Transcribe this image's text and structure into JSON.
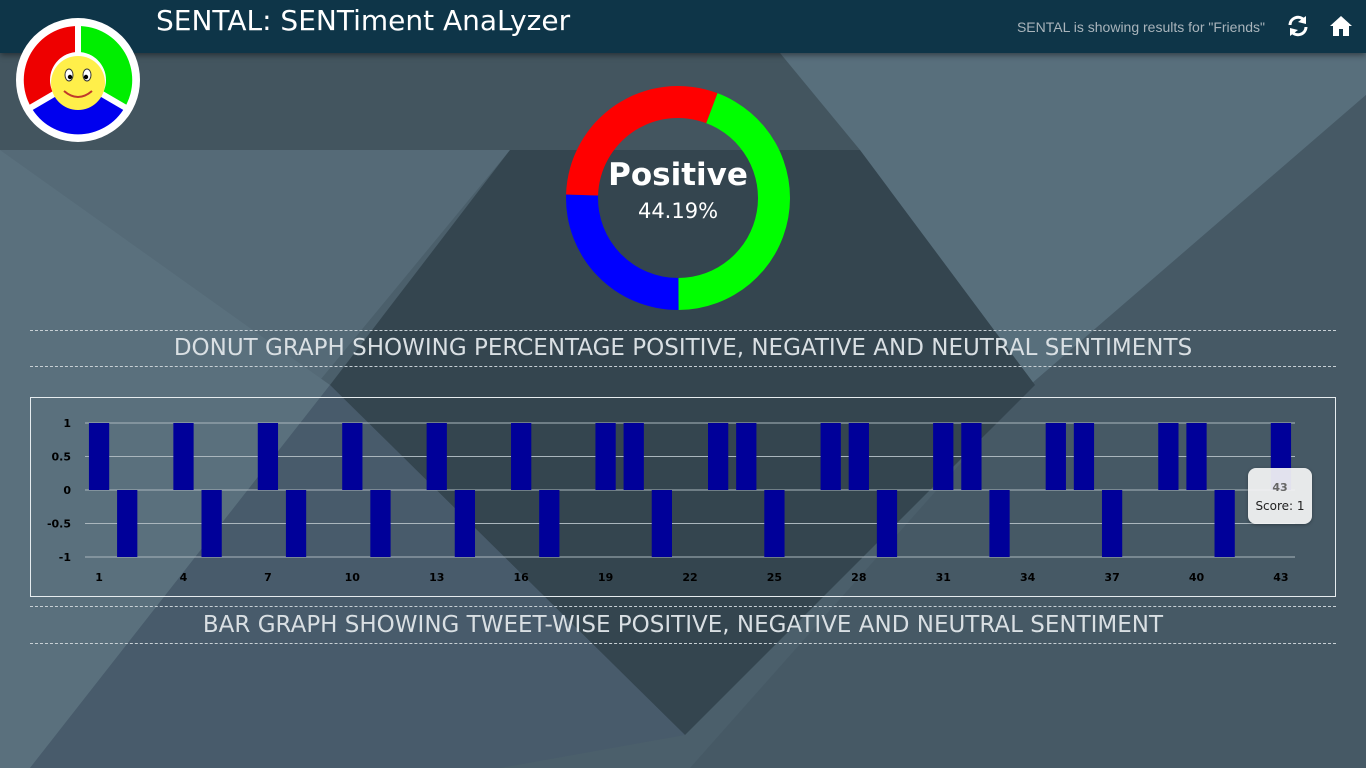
{
  "header": {
    "title": "SENTAL: SENTiment AnaLyzer",
    "status": "SENTAL is showing results for \"Friends\"",
    "refresh_icon": "refresh-icon",
    "home_icon": "home-icon"
  },
  "colors": {
    "header_bg": "#0e3548",
    "positive": "#00ff00",
    "negative": "#ff0000",
    "neutral": "#0000ff",
    "bar": "#000099"
  },
  "donut": {
    "label": "Positive",
    "percent": "44.19%"
  },
  "captions": {
    "donut": "DONUT GRAPH SHOWING PERCENTAGE POSITIVE, NEGATIVE AND NEUTRAL SENTIMENTS",
    "bar": "BAR GRAPH SHOWING TWEET-WISE POSITIVE, NEGATIVE AND NEUTRAL SENTIMENT"
  },
  "tooltip": {
    "title": "43",
    "text": "Score: 1"
  },
  "chart_data": [
    {
      "type": "pie",
      "categories": [
        "Positive",
        "Neutral",
        "Negative"
      ],
      "values": [
        44.19,
        25.58,
        30.23
      ],
      "colors": [
        "#00ff00",
        "#0000ff",
        "#ff0000"
      ]
    },
    {
      "type": "bar",
      "x": [
        1,
        2,
        3,
        4,
        5,
        6,
        7,
        8,
        9,
        10,
        11,
        12,
        13,
        14,
        15,
        16,
        17,
        18,
        19,
        20,
        21,
        22,
        23,
        24,
        25,
        26,
        27,
        28,
        29,
        30,
        31,
        32,
        33,
        34,
        35,
        36,
        37,
        38,
        39,
        40,
        41,
        42,
        43
      ],
      "values": [
        1,
        -1,
        0,
        1,
        -1,
        0,
        1,
        -1,
        0,
        1,
        -1,
        0,
        1,
        -1,
        0,
        1,
        -1,
        0,
        1,
        1,
        -1,
        0,
        1,
        1,
        -1,
        0,
        1,
        1,
        -1,
        0,
        1,
        1,
        -1,
        0,
        1,
        1,
        -1,
        0,
        1,
        1,
        -1,
        0,
        1
      ],
      "yticks": [
        "1",
        "0.5",
        "0",
        "-0.5",
        "-1"
      ],
      "xticks": [
        "1",
        "4",
        "7",
        "10",
        "13",
        "16",
        "19",
        "22",
        "25",
        "28",
        "31",
        "34",
        "37",
        "40",
        "43"
      ],
      "ylim": [
        -1,
        1
      ]
    }
  ]
}
